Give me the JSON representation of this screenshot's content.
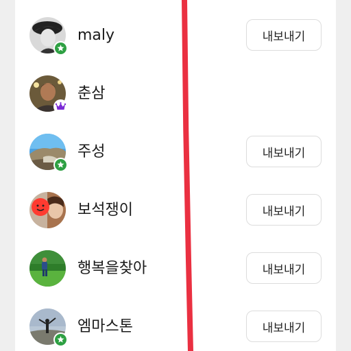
{
  "rows": [
    {
      "name": "maly",
      "badge": "star",
      "button": "내보내기"
    },
    {
      "name": "춘삼",
      "badge": "crown",
      "button": ""
    },
    {
      "name": "주성",
      "badge": "star",
      "button": "내보내기"
    },
    {
      "name": "보석쟁이",
      "badge": "none",
      "button": "내보내기"
    },
    {
      "name": "행복을찾아",
      "badge": "none",
      "button": "내보내기"
    },
    {
      "name": "엠마스톤",
      "badge": "star",
      "button": "내보내기"
    }
  ],
  "colors": {
    "star_badge": "#2ea043",
    "crown_badge": "#7b2bd6",
    "annotation_line": "#e8192c"
  }
}
